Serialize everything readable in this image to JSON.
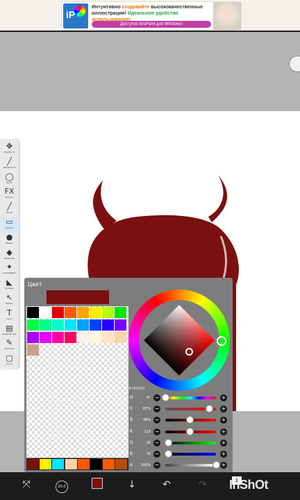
{
  "ad": {
    "line1a": "Интуитивно ",
    "line1b": "создавайте",
    "line1c": " высококачественные",
    "line2a": "иллюстрации! ",
    "line2b": "Идеальное удобство",
    "line2c": " использования!",
    "button": "Доступно ibisPaint для Windows!",
    "logo_text": "iP"
  },
  "toolbar": {
    "items": [
      {
        "icon": "✥",
        "label": "Transform"
      },
      {
        "icon": "╱",
        "label": "Прожектор"
      },
      {
        "icon": "◯",
        "label": "Лассо"
      },
      {
        "icon": "FX",
        "label": "Фильтр"
      },
      {
        "icon": "╱",
        "label": "Кисть"
      },
      {
        "icon": "▭",
        "label": "Ластик"
      },
      {
        "icon": "●",
        "label": "Палец"
      },
      {
        "icon": "◆",
        "label": "Размытие"
      },
      {
        "icon": "✦",
        "label": "Спецэффект"
      },
      {
        "icon": "◣",
        "label": "Заливка"
      },
      {
        "icon": "↖",
        "label": "Выбор"
      },
      {
        "icon": "T",
        "label": "Текст"
      },
      {
        "icon": "▤",
        "label": "Разделитель"
      },
      {
        "icon": "✎",
        "label": "Пипетка"
      },
      {
        "icon": "▢",
        "label": "Холст"
      }
    ]
  },
  "color_panel": {
    "title": "Цвет",
    "current_color": "#7b1010",
    "hex": "#7B1010",
    "palette": [
      "#000000",
      "#ffffff",
      "#e60000",
      "#ff5a00",
      "#ffa500",
      "#ffee00",
      "#b4ff00",
      "#00e600",
      "#00ff40",
      "#00ff8c",
      "#00ffc8",
      "#00e6ff",
      "#00a0ff",
      "#0040ff",
      "#2800ff",
      "#7800ff",
      "#aa00ff",
      "#e600ff",
      "#ff00aa",
      "#ff0060",
      "#fff0f0",
      "#fff6dc",
      "#ffe4c0",
      "#ffd2a8",
      "#c8a08c"
    ],
    "recent": [
      "#7b1010",
      "#ffee00",
      "#00e6ff",
      "#ffd2a8",
      "#ff5a00",
      "#000000",
      "#ff5a00",
      "#b45000"
    ],
    "sliders": [
      {
        "key": "H",
        "value": "0°",
        "pos": 0.0,
        "colors": [
          "#ff0000",
          "#ffff00",
          "#00ff00",
          "#00ffff",
          "#0000ff",
          "#ff00ff",
          "#ff0000"
        ]
      },
      {
        "key": "S",
        "value": "87%",
        "pos": 0.87,
        "colors": [
          "#555555",
          "#ff0000"
        ]
      },
      {
        "key": "B",
        "value": "48%",
        "pos": 0.48,
        "colors": [
          "#000000",
          "#ff0000"
        ]
      },
      {
        "key": "R",
        "value": "123",
        "pos": 0.48,
        "colors": [
          "#000000",
          "#ff0000"
        ]
      },
      {
        "key": "G",
        "value": "16",
        "pos": 0.06,
        "colors": [
          "#000000",
          "#00ff00"
        ]
      },
      {
        "key": "B",
        "value": "16",
        "pos": 0.06,
        "colors": [
          "#000000",
          "#0000ff"
        ]
      },
      {
        "key": "α",
        "value": "100%",
        "pos": 1.0,
        "colors": [
          "#444444",
          "#ffffff"
        ]
      }
    ]
  },
  "bottom_bar": {
    "brush_size": "20.0",
    "watermark": "InShOt",
    "layer_count": "1"
  }
}
